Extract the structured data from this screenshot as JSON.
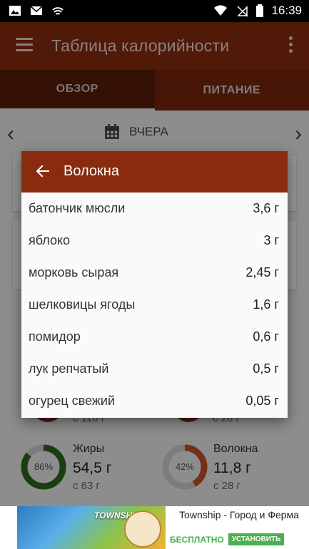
{
  "status_bar": {
    "left_icons": [
      "image-icon",
      "email-icon",
      "signal-icon"
    ],
    "right_icons": [
      "wifi-icon",
      "no-sim-icon",
      "battery-icon"
    ],
    "time": "16:39"
  },
  "app_bar": {
    "title": "Таблица калорийности",
    "color": "#8a2b0f"
  },
  "tabs": [
    {
      "label": "ОБЗОР",
      "active": true
    },
    {
      "label": "ПИТАНИЕ",
      "active": false
    }
  ],
  "date_nav": {
    "prev_icon": "chevron-left-icon",
    "next_icon": "chevron-right-icon",
    "calendar_icon": "calendar-icon",
    "label": "ВЧЕРА"
  },
  "nutrients_behind": [
    {
      "partial_goal": "с 110 г"
    },
    {
      "partial_goal": "с 28 г"
    }
  ],
  "nutrients": [
    {
      "name": "Жиры",
      "percent": 86,
      "percent_label": "86%",
      "value": "54,5 г",
      "goal": "с 63 г",
      "color": "#2e6b1f"
    },
    {
      "name": "Волокна",
      "percent": 42,
      "percent_label": "42%",
      "value": "11,8 г",
      "goal": "с 28 г",
      "color": "#c8532a"
    }
  ],
  "dialog": {
    "title": "Волокна",
    "back_icon": "arrow-left-icon",
    "rows": [
      {
        "name": "батончик мюсли",
        "value": "3,6 г"
      },
      {
        "name": "яблоко",
        "value": "3 г"
      },
      {
        "name": "морковь сырая",
        "value": "2,45 г"
      },
      {
        "name": "шелковицы ягоды",
        "value": "1,6 г"
      },
      {
        "name": "помидор",
        "value": "0,6 г"
      },
      {
        "name": "лук репчатый",
        "value": "0,5 г"
      },
      {
        "name": "огурец свежий",
        "value": "0,05 г"
      }
    ]
  },
  "ad": {
    "logo_text": "TOWNSHIP",
    "title": "Township - Город и Ферма",
    "free_label": "БЕСПЛАТНО",
    "install_label": "УСТАНОВИТЬ"
  }
}
